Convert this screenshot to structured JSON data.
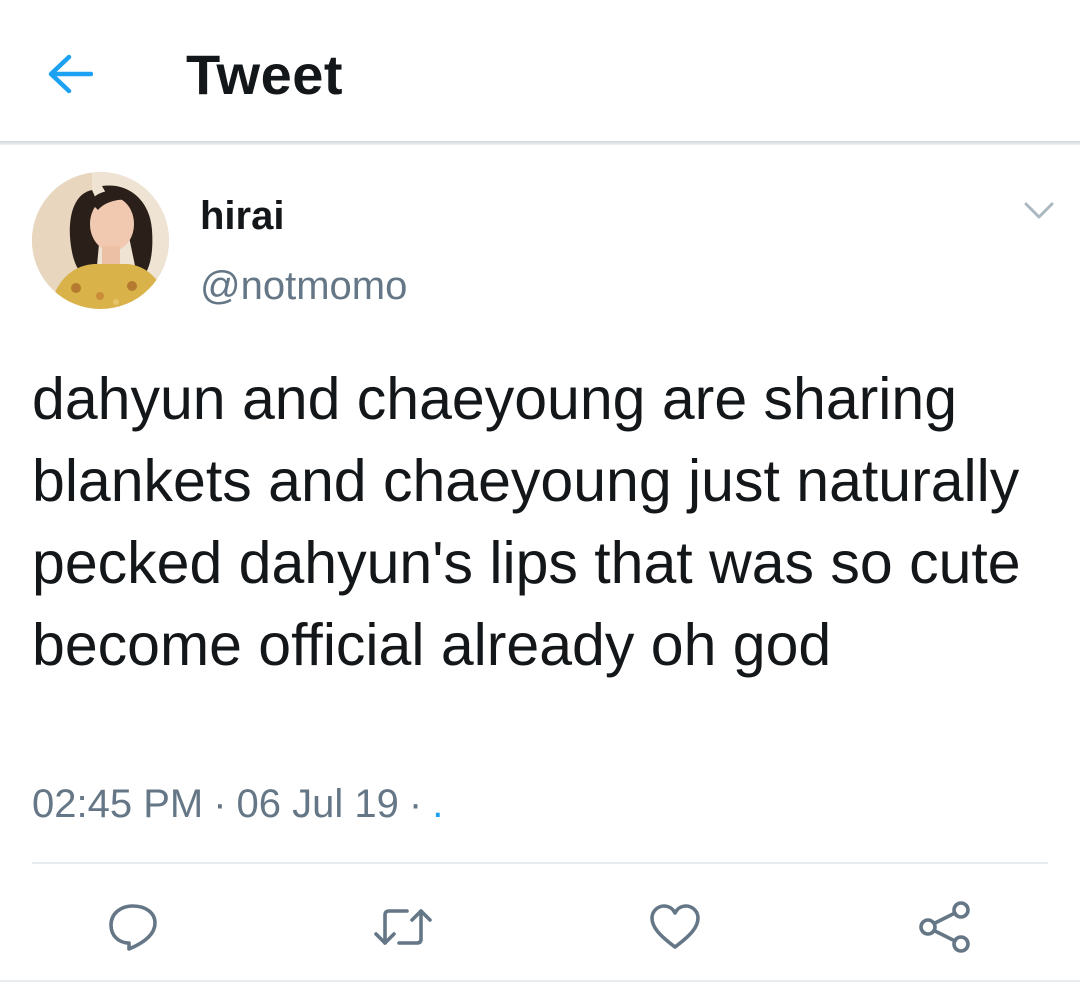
{
  "app": {
    "title": "Tweet",
    "back_icon": "arrow-left-icon",
    "accent_color": "#1da1f2"
  },
  "tweet": {
    "author": {
      "display_name": "hirai",
      "handle": "@notmomo",
      "avatar": "avatar-photo"
    },
    "text": "dahyun and chaeyoung are sharing blankets and chaeyoung just naturally pecked dahyun's lips that was so cute become official already oh god",
    "time": "02:45 PM",
    "date": "06 Jul 19",
    "separator": "·",
    "via": "."
  },
  "actions": [
    {
      "name": "reply",
      "icon": "reply-icon"
    },
    {
      "name": "retweet",
      "icon": "retweet-icon"
    },
    {
      "name": "like",
      "icon": "heart-icon"
    },
    {
      "name": "share",
      "icon": "share-icon"
    }
  ],
  "colors": {
    "text_primary": "#14171a",
    "text_secondary": "#657786",
    "divider": "#e6ecf0"
  }
}
